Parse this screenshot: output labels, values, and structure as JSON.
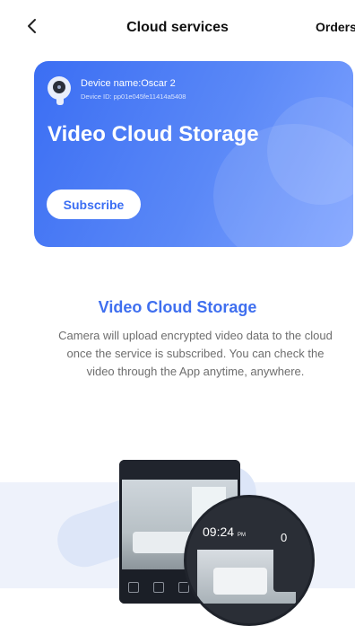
{
  "header": {
    "title": "Cloud services",
    "orders_label": "Orders"
  },
  "card": {
    "device_name": "Device name:Oscar 2",
    "device_id": "Device ID: pp01e045fe11414a5408",
    "title": "Video Cloud Storage",
    "subscribe_label": "Subscribe"
  },
  "info": {
    "title": "Video Cloud Storage",
    "description": "Camera will upload encrypted video data to the cloud once the service is subscribed. You can check the video through the App anytime, anywhere."
  },
  "illustration": {
    "time_text": "09:24",
    "time_suffix": "PM",
    "right_time": "0"
  },
  "colors": {
    "accent": "#3f6fef",
    "card_start": "#3b6ef3",
    "card_end": "#7fa3ff"
  }
}
